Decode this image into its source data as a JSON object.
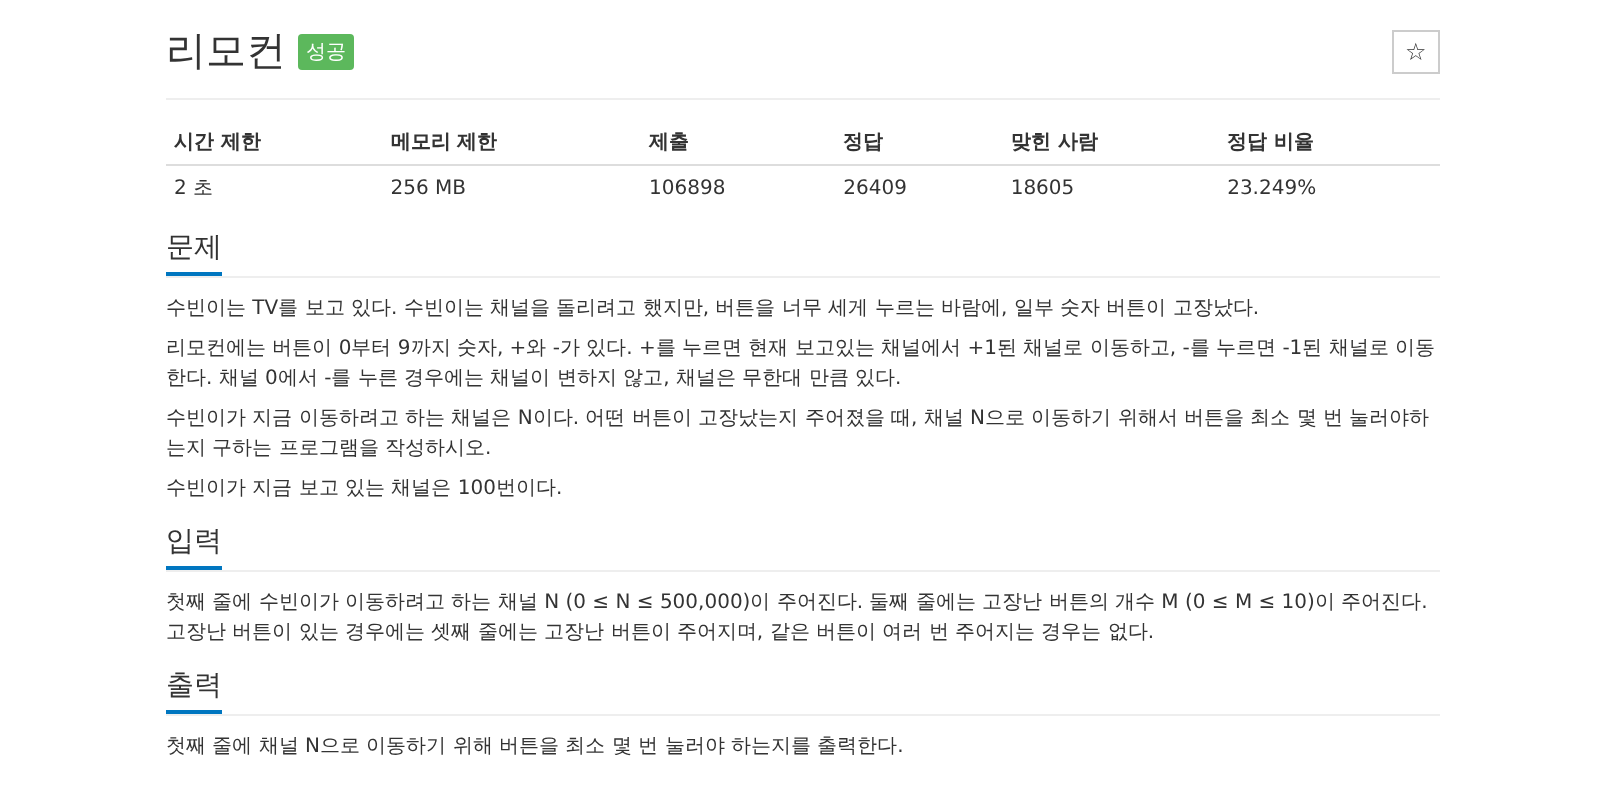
{
  "title": "리모컨",
  "badge": "성공",
  "star_button": "☆",
  "stats": {
    "columns": [
      "시간 제한",
      "메모리 제한",
      "제출",
      "정답",
      "맞힌 사람",
      "정답 비율"
    ],
    "row": [
      "2 초",
      "256 MB",
      "106898",
      "26409",
      "18605",
      "23.249%"
    ]
  },
  "sections": [
    {
      "heading": "문제",
      "paragraphs": [
        "수빈이는 TV를 보고 있다. 수빈이는 채널을 돌리려고 했지만, 버튼을 너무 세게 누르는 바람에, 일부 숫자 버튼이 고장났다.",
        "리모컨에는 버튼이 0부터 9까지 숫자, +와 -가 있다. +를 누르면 현재 보고있는 채널에서 +1된 채널로 이동하고, -를 누르면 -1된 채널로 이동한다. 채널 0에서 -를 누른 경우에는 채널이 변하지 않고, 채널은 무한대 만큼 있다.",
        "수빈이가 지금 이동하려고 하는 채널은 N이다. 어떤 버튼이 고장났는지 주어졌을 때, 채널 N으로 이동하기 위해서 버튼을 최소 몇 번 눌러야하는지 구하는 프로그램을 작성하시오.",
        "수빈이가 지금 보고 있는 채널은 100번이다."
      ]
    },
    {
      "heading": "입력",
      "paragraphs": [
        "첫째 줄에 수빈이가 이동하려고 하는 채널 N (0 ≤ N ≤ 500,000)이 주어진다. 둘째 줄에는 고장난 버튼의 개수 M (0 ≤ M ≤ 10)이 주어진다. 고장난 버튼이 있는 경우에는 셋째 줄에는 고장난 버튼이 주어지며, 같은 버튼이 여러 번 주어지는 경우는 없다."
      ]
    },
    {
      "heading": "출력",
      "paragraphs": [
        "첫째 줄에 채널 N으로 이동하기 위해 버튼을 최소 몇 번 눌러야 하는지를 출력한다."
      ]
    }
  ]
}
